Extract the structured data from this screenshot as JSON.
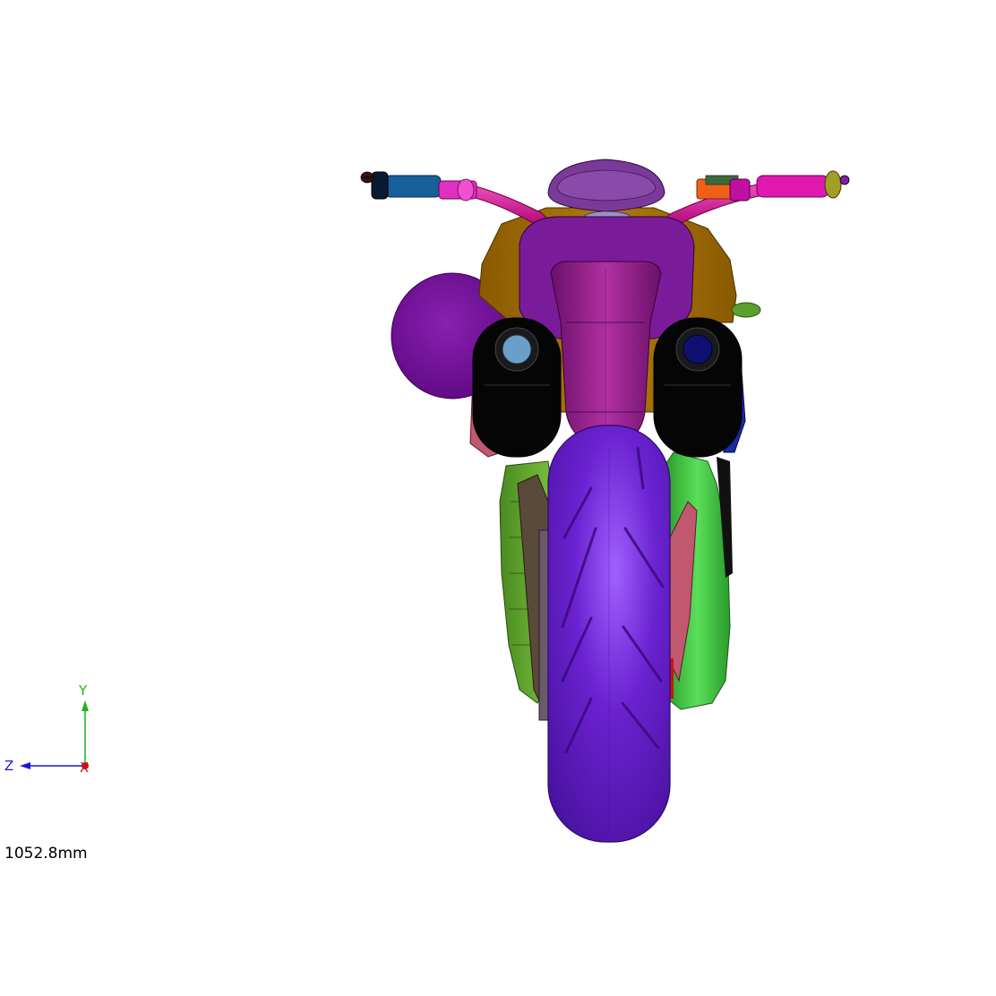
{
  "viewport": {
    "background": "#ffffff",
    "model": "motorcycle-front-view"
  },
  "triad": {
    "y_label": "Y",
    "z_label": "Z",
    "x_label": "X",
    "colors": {
      "y": "#20b020",
      "z": "#1a1ad0",
      "x": "#c81414"
    }
  },
  "scale": {
    "readout": "1052.8mm"
  },
  "colors": {
    "tire": "#6a22c8",
    "tire_highlight": "#9a55ff",
    "fender": "#8a1e8a",
    "headlight_cowl": "#7a1c9a",
    "tank": "#a06a00",
    "mirror_disc": "#7a10a0",
    "fork_slider": "#050505",
    "radiator": "#3cc83c",
    "handlebar": "#d0188c",
    "grip_left": "#18609a",
    "grip_right": "#e018b0",
    "lever_orange": "#f06018",
    "lever_tip": "#a0a028",
    "caliper": "#c05870",
    "chain": "#6a5a6a",
    "dash": "#6a2a8a"
  }
}
